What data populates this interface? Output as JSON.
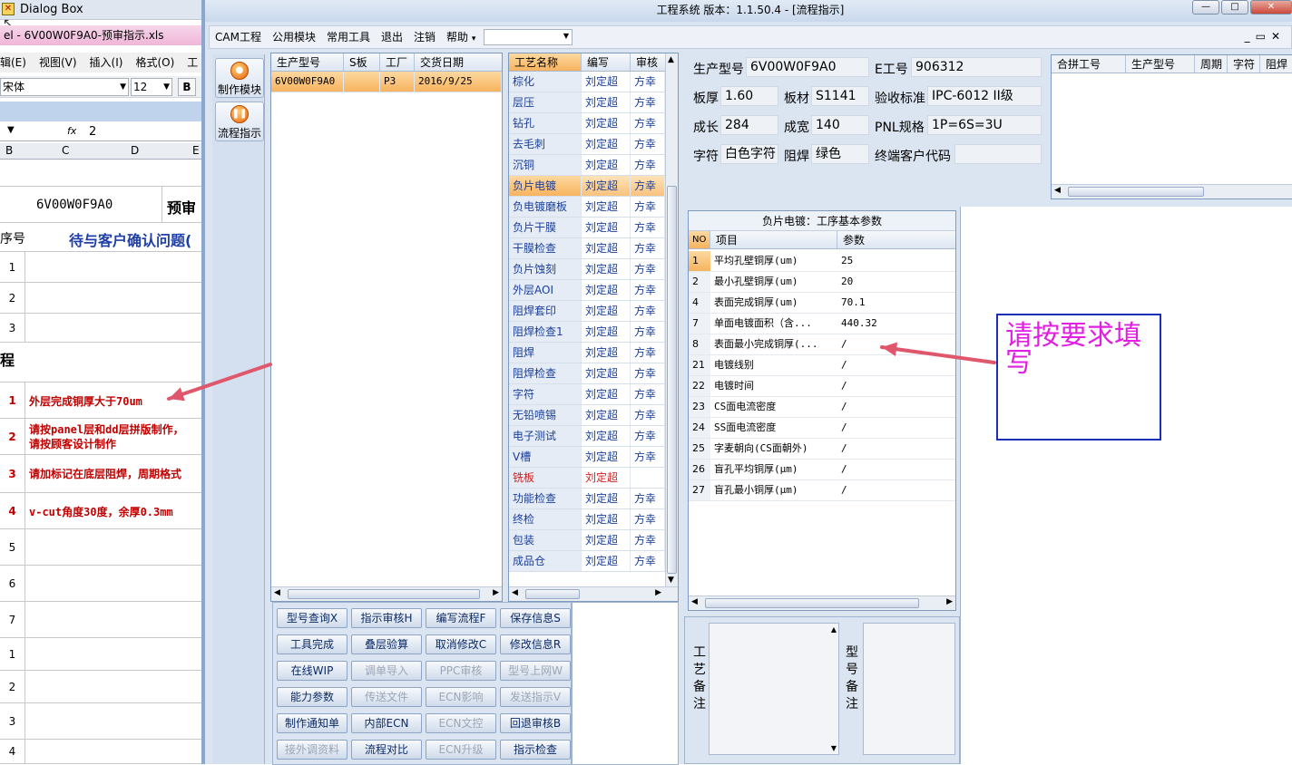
{
  "excel": {
    "window_title": "Dialog Box",
    "file_title": "el - 6V00W0F9A0-预审指示.xls",
    "menu": [
      "辑(E)",
      "视图(V)",
      "插入(I)",
      "格式(O)",
      "工"
    ],
    "font_name": "宋体",
    "font_size": "12",
    "bold_label": "B",
    "fx_label": "fx",
    "fx_value": "2",
    "columns": [
      "B",
      "C",
      "D",
      "E"
    ],
    "part_code": "6V00W0F9A0",
    "prereview": "预审",
    "seq_header": "序号",
    "issue_header": "待与客户确认问题(",
    "process_label": "程",
    "rows_top": [
      "1",
      "2",
      "3"
    ],
    "issues": [
      {
        "num": "1",
        "text": "外层完成铜厚大于70um"
      },
      {
        "num": "2",
        "text": "请按panel层和dd层拼版制作，",
        "text2": "请按顾客设计制作"
      },
      {
        "num": "3",
        "text": "请加标记在底层阻焊，周期格式"
      },
      {
        "num": "4",
        "text": "v-cut角度30度，余厚0.3mm"
      }
    ],
    "rows_bottom": [
      "5",
      "6",
      "7",
      "1",
      "2",
      "3",
      "4"
    ]
  },
  "app": {
    "title": "工程系统   版本：1.1.50.4 - [流程指示]",
    "window_buttons": [
      "—",
      "□",
      "✕"
    ],
    "menu": [
      "CAM工程",
      "公用模块",
      "常用工具",
      "退出",
      "注销",
      "帮助"
    ],
    "menu_help_arrow": "▾",
    "mdi_buttons": [
      "_",
      "▭",
      "✕"
    ],
    "side_buttons": [
      {
        "label": "制作模块"
      },
      {
        "label": "流程指示"
      }
    ]
  },
  "orders": {
    "columns": [
      "生产型号",
      "S板",
      "工厂",
      "交货日期"
    ],
    "rows": [
      {
        "part": "6V00W0F9A0",
        "s": "",
        "factory": "P3",
        "date": "2016/9/25"
      }
    ]
  },
  "processes": {
    "columns": [
      "工艺名称",
      "编写",
      "审核"
    ],
    "rows": [
      {
        "name": "棕化",
        "writer": "刘定超",
        "reviewer": "方幸"
      },
      {
        "name": "层压",
        "writer": "刘定超",
        "reviewer": "方幸"
      },
      {
        "name": "钻孔",
        "writer": "刘定超",
        "reviewer": "方幸"
      },
      {
        "name": "去毛刺",
        "writer": "刘定超",
        "reviewer": "方幸"
      },
      {
        "name": "沉铜",
        "writer": "刘定超",
        "reviewer": "方幸"
      },
      {
        "name": "负片电镀",
        "writer": "刘定超",
        "reviewer": "方幸"
      },
      {
        "name": "负电镀磨板",
        "writer": "刘定超",
        "reviewer": "方幸"
      },
      {
        "name": "负片干膜",
        "writer": "刘定超",
        "reviewer": "方幸"
      },
      {
        "name": "干膜检查",
        "writer": "刘定超",
        "reviewer": "方幸"
      },
      {
        "name": "负片蚀刻",
        "writer": "刘定超",
        "reviewer": "方幸"
      },
      {
        "name": "外层AOI",
        "writer": "刘定超",
        "reviewer": "方幸"
      },
      {
        "name": "阻焊套印",
        "writer": "刘定超",
        "reviewer": "方幸"
      },
      {
        "name": "阻焊检查1",
        "writer": "刘定超",
        "reviewer": "方幸"
      },
      {
        "name": "阻焊",
        "writer": "刘定超",
        "reviewer": "方幸"
      },
      {
        "name": "阻焊检查",
        "writer": "刘定超",
        "reviewer": "方幸"
      },
      {
        "name": "字符",
        "writer": "刘定超",
        "reviewer": "方幸"
      },
      {
        "name": "无铅喷锡",
        "writer": "刘定超",
        "reviewer": "方幸"
      },
      {
        "name": "电子测试",
        "writer": "刘定超",
        "reviewer": "方幸"
      },
      {
        "name": "V槽",
        "writer": "刘定超",
        "reviewer": "方幸"
      },
      {
        "name": "铣板",
        "writer": "刘定超",
        "reviewer": ""
      },
      {
        "name": "功能检查",
        "writer": "刘定超",
        "reviewer": "方幸"
      },
      {
        "name": "终检",
        "writer": "刘定超",
        "reviewer": "方幸"
      },
      {
        "name": "包装",
        "writer": "刘定超",
        "reviewer": "方幸"
      },
      {
        "name": "成品仓",
        "writer": "刘定超",
        "reviewer": "方幸"
      }
    ]
  },
  "buttons": [
    {
      "label": "型号查询X",
      "disabled": false
    },
    {
      "label": "指示审核H",
      "disabled": false
    },
    {
      "label": "编写流程F",
      "disabled": false
    },
    {
      "label": "保存信息S",
      "disabled": false
    },
    {
      "label": "工具完成",
      "disabled": false
    },
    {
      "label": "叠层验算",
      "disabled": false
    },
    {
      "label": "取消修改C",
      "disabled": false
    },
    {
      "label": "修改信息R",
      "disabled": false
    },
    {
      "label": "在线WIP",
      "disabled": false
    },
    {
      "label": "调单导入",
      "disabled": true
    },
    {
      "label": "PPC审核",
      "disabled": true
    },
    {
      "label": "型号上网W",
      "disabled": true
    },
    {
      "label": "能力参数",
      "disabled": false
    },
    {
      "label": "传送文件",
      "disabled": true
    },
    {
      "label": "ECN影响",
      "disabled": true
    },
    {
      "label": "发送指示V",
      "disabled": true
    },
    {
      "label": "制作通知单",
      "disabled": false
    },
    {
      "label": "内部ECN",
      "disabled": false
    },
    {
      "label": "ECN文控",
      "disabled": true
    },
    {
      "label": "回退审核B",
      "disabled": false
    },
    {
      "label": "接外调资料",
      "disabled": true
    },
    {
      "label": "流程对比",
      "disabled": false
    },
    {
      "label": "ECN升级",
      "disabled": true
    },
    {
      "label": "指示检查",
      "disabled": false
    }
  ],
  "info": {
    "part_label": "生产型号",
    "part_value": "6V00W0F9A0",
    "e_label": "E工号",
    "e_value": "906312",
    "thick_label": "板厚",
    "thick_value": "1.60",
    "material_label": "板材",
    "material_value": "S1141",
    "standard_label": "验收标准",
    "standard_value": "IPC-6012 II级",
    "length_label": "成长",
    "length_value": "284",
    "width_label": "成宽",
    "width_value": "140",
    "pnl_label": "PNL规格",
    "pnl_value": "1P=6S=3U",
    "char_label": "字符",
    "char_value": "白色字符",
    "mask_label": "阻焊",
    "mask_value": "绿色",
    "customer_label": "终端客户代码",
    "customer_value": ""
  },
  "merge_table": {
    "columns": [
      "合拼工号",
      "生产型号",
      "周期",
      "字符",
      "阻焊"
    ]
  },
  "params": {
    "title": "负片电镀：工序基本参数",
    "columns": [
      "NO",
      "项目",
      "参数"
    ],
    "rows": [
      {
        "no": "1",
        "item": "平均孔壁铜厚(um)",
        "value": "25"
      },
      {
        "no": "2",
        "item": "最小孔壁铜厚(um)",
        "value": "20"
      },
      {
        "no": "4",
        "item": "表面完成铜厚(um)",
        "value": "70.1"
      },
      {
        "no": "7",
        "item": "单面电镀面积（含...",
        "value": "440.32"
      },
      {
        "no": "8",
        "item": "表面最小完成铜厚(...",
        "value": "/"
      },
      {
        "no": "21",
        "item": "电镀线别",
        "value": "/"
      },
      {
        "no": "22",
        "item": "电镀时间",
        "value": "/"
      },
      {
        "no": "23",
        "item": "CS面电流密度",
        "value": "/"
      },
      {
        "no": "24",
        "item": "SS面电流密度",
        "value": "/"
      },
      {
        "no": "25",
        "item": "字麦朝向(CS面朝外)",
        "value": "/"
      },
      {
        "no": "26",
        "item": "盲孔平均铜厚(μm)",
        "value": "/"
      },
      {
        "no": "27",
        "item": "盲孔最小铜厚(μm)",
        "value": "/"
      }
    ]
  },
  "notes": {
    "process_note_label": "工艺备注",
    "part_note_label": "型号备注"
  },
  "callout": {
    "text": "请按要求填写",
    "color": "#e020e0",
    "border_color": "#1c2fb8"
  },
  "arrow_color": "#e0566a"
}
